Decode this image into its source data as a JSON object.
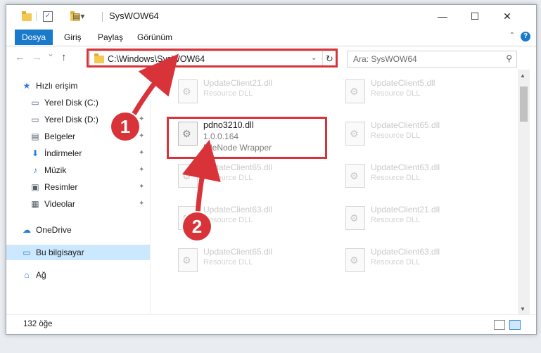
{
  "window": {
    "title": "SysWOW64",
    "controls": {
      "minimize": "—",
      "maximize": "☐",
      "close": "✕"
    }
  },
  "ribbon": {
    "tabs": [
      "Dosya",
      "Giriş",
      "Paylaş",
      "Görünüm"
    ],
    "help": "?"
  },
  "nav": {
    "back": "←",
    "forward": "→",
    "recent": "⌄",
    "up": "↑",
    "address": "C:\\Windows\\SysWOW64",
    "refresh": "↻",
    "search_placeholder": "Ara: SysWOW64",
    "search_icon": "⚲"
  },
  "sidebar": {
    "items": [
      {
        "label": "Hızlı erişim",
        "icon": "star-icon",
        "glyph": "★"
      },
      {
        "label": "Yerel Disk (C:)",
        "icon": "drive-icon",
        "glyph": "▭",
        "pinned": true
      },
      {
        "label": "Yerel Disk (D:)",
        "icon": "drive-icon",
        "glyph": "▭",
        "pinned": true
      },
      {
        "label": "Belgeler",
        "icon": "documents-icon",
        "glyph": "▤",
        "pinned": true
      },
      {
        "label": "İndirmeler",
        "icon": "download-icon",
        "glyph": "⬇",
        "pinned": true
      },
      {
        "label": "Müzik",
        "icon": "music-icon",
        "glyph": "♪",
        "pinned": true
      },
      {
        "label": "Resimler",
        "icon": "pictures-icon",
        "glyph": "▣",
        "pinned": true
      },
      {
        "label": "Videolar",
        "icon": "videos-icon",
        "glyph": "▦",
        "pinned": true
      },
      {
        "label": "OneDrive",
        "icon": "cloud-icon",
        "glyph": "☁"
      },
      {
        "label": "Bu bilgisayar",
        "icon": "computer-icon",
        "glyph": "▭",
        "selected": true
      },
      {
        "label": "Ağ",
        "icon": "network-icon",
        "glyph": "⌂"
      }
    ],
    "pin_glyph": "✦"
  },
  "files": {
    "left": [
      {
        "name": "UpdateClient21.dll",
        "type": "Resource DLL"
      },
      {
        "name": "pdno3210.dll",
        "version": "1.0.0.164",
        "description": "FileNode Wrapper",
        "active": true
      },
      {
        "name": "UpdateClient65.dll",
        "type": "Resource DLL"
      },
      {
        "name": "UpdateClient63.dll",
        "type": "Resource DLL"
      },
      {
        "name": "UpdateClient65.dll",
        "type": "Resource DLL"
      }
    ],
    "right": [
      {
        "name": "UpdateClient5.dll",
        "type": "Resource DLL"
      },
      {
        "name": "UpdateClient65.dll",
        "type": "Resource DLL"
      },
      {
        "name": "UpdateClient63.dll",
        "type": "Resource DLL"
      },
      {
        "name": "UpdateClient21.dll",
        "type": "Resource DLL"
      },
      {
        "name": "UpdateClient63.dll",
        "type": "Resource DLL"
      }
    ]
  },
  "status": {
    "count": "132 öğe"
  },
  "annotations": {
    "marker1": "1",
    "marker2": "2",
    "color": "#d9333a"
  }
}
